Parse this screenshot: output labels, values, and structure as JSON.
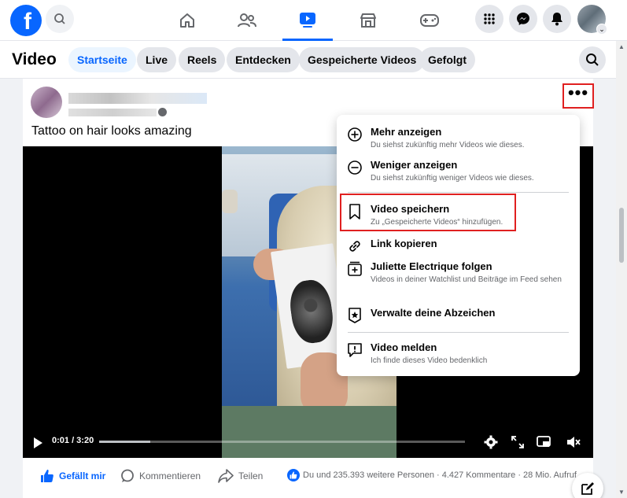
{
  "topbar": {
    "logo_letter": "f",
    "nav_tabs": [
      {
        "name": "home-icon",
        "active": false
      },
      {
        "name": "friends-icon",
        "active": false
      },
      {
        "name": "video-icon",
        "active": true
      },
      {
        "name": "marketplace-icon",
        "active": false
      },
      {
        "name": "gaming-icon",
        "active": false
      }
    ],
    "right_icons": [
      "menu-grid-icon",
      "messenger-icon",
      "notifications-icon"
    ]
  },
  "subheader": {
    "title": "Video",
    "tabs": [
      {
        "label": "Startseite",
        "active": true
      },
      {
        "label": "Live",
        "active": false
      },
      {
        "label": "Reels",
        "active": false
      },
      {
        "label": "Entdecken",
        "active": false
      },
      {
        "label": "Gespeicherte Videos",
        "active": false
      },
      {
        "label": "Gefolgt",
        "active": false
      }
    ]
  },
  "post": {
    "caption": "Tattoo on hair looks amazing",
    "more_label": "•••",
    "video": {
      "time": "0:01 / 3:20",
      "progress": 0.14
    },
    "actions": {
      "like": "Gefällt mir",
      "comment": "Kommentieren",
      "share": "Teilen"
    },
    "stats": "Du und 235.393 weitere Personen · 4.427 Kommentare · 28 Mio. Aufruf"
  },
  "menu": {
    "items": [
      {
        "title": "Mehr anzeigen",
        "subtitle": "Du siehst zukünftig mehr Videos wie dieses."
      },
      {
        "title": "Weniger anzeigen",
        "subtitle": "Du siehst zukünftig weniger Videos wie dieses."
      },
      {
        "title": "Video speichern",
        "subtitle": "Zu „Gespeicherte Videos“ hinzufügen."
      },
      {
        "title": "Link kopieren",
        "subtitle": ""
      },
      {
        "title": "Juliette Electrique folgen",
        "subtitle": "Videos in deiner Watchlist und Beiträge im Feed sehen"
      },
      {
        "title": "Verwalte deine Abzeichen",
        "subtitle": ""
      },
      {
        "title": "Video melden",
        "subtitle": "Ich finde dieses Video bedenklich"
      }
    ]
  },
  "colors": {
    "brand": "#0866ff",
    "highlight": "#e02020"
  }
}
